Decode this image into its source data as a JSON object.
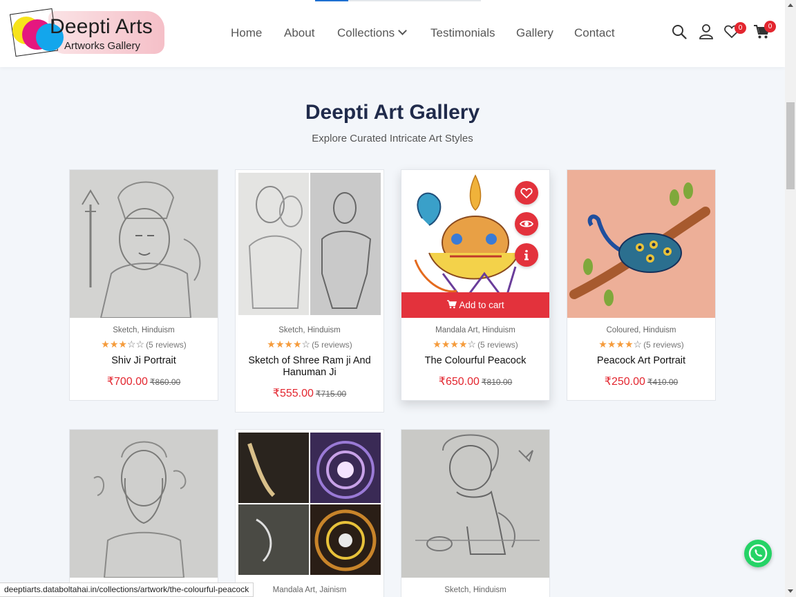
{
  "logo": {
    "title": "Deepti Arts",
    "subtitle": "Artworks Gallery"
  },
  "nav": {
    "items": [
      "Home",
      "About",
      "Collections",
      "Testimonials",
      "Gallery",
      "Contact"
    ]
  },
  "header_icons": {
    "search": "search-icon",
    "account": "user-icon",
    "wishlist": "heart-icon",
    "cart": "cart-icon",
    "wishlist_count": "0",
    "cart_count": "0"
  },
  "section": {
    "title": "Deepti Art Gallery",
    "subtitle": "Explore Curated Intricate Art Styles"
  },
  "products": [
    {
      "categories": [
        "Sketch",
        "Hinduism"
      ],
      "rating": 3,
      "reviews": "(5 reviews)",
      "name": "Shiv Ji Portrait",
      "price": "₹700.00",
      "old_price": "₹860.00"
    },
    {
      "categories": [
        "Sketch",
        "Hinduism"
      ],
      "rating": 4,
      "reviews": "(5 reviews)",
      "name": "Sketch of Shree Ram ji And Hanuman Ji",
      "price": "₹555.00",
      "old_price": "₹715.00"
    },
    {
      "categories": [
        "Mandala Art",
        "Hinduism"
      ],
      "rating": 4,
      "reviews": "(5 reviews)",
      "name": "The Colourful Peacock",
      "price": "₹650.00",
      "old_price": "₹810.00",
      "hover_action": "Add to cart"
    },
    {
      "categories": [
        "Coloured",
        "Hinduism"
      ],
      "rating": 4,
      "reviews": "(5 reviews)",
      "name": "Peacock Art Portrait",
      "price": "₹250.00",
      "old_price": "₹410.00"
    },
    {
      "categories": [],
      "name": "",
      "price": ""
    },
    {
      "categories": [
        "Mandala Art",
        "Jainism"
      ],
      "name": "",
      "price": ""
    },
    {
      "categories": [
        "Sketch",
        "Hinduism"
      ],
      "name": "",
      "price": ""
    }
  ],
  "status_bar": {
    "url": "deeptiarts.databoltahai.in/collections/artwork/the-colourful-peacock"
  },
  "colors": {
    "accent": "#e3262f",
    "heading": "#202b4b",
    "star": "#f59b3b",
    "whatsapp": "#25d366"
  }
}
